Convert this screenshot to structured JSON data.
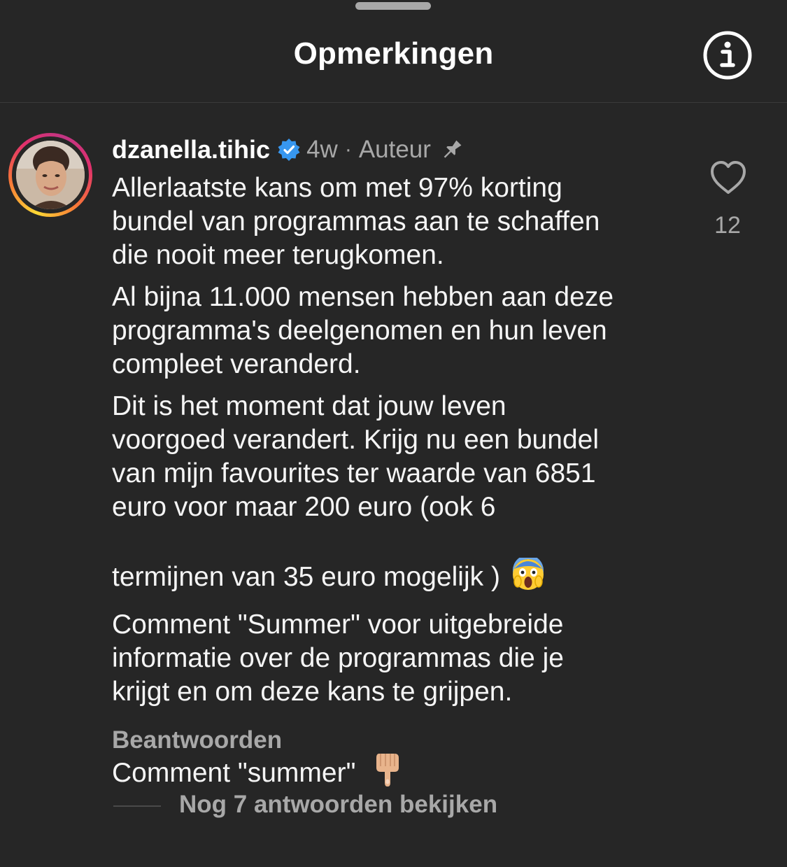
{
  "header": {
    "title": "Opmerkingen",
    "info_icon": "info-icon"
  },
  "comment": {
    "username": "dzanella.tihic",
    "verified_icon": "verified-badge-icon",
    "time": "4w",
    "separator": "·",
    "role": "Auteur",
    "pin_icon": "pin-icon",
    "paragraphs": [
      "Allerlaatste kans om met 97% korting\nbundel van programmas aan te schaffen\ndie nooit meer terugkomen.",
      "Al bijna 11.000 mensen hebben aan deze\nprogramma's deelgenomen en hun leven\ncompleet veranderd.",
      "Dit is het moment dat jouw leven\nvoorgoed verandert. Krijg nu een bundel\nvan mijn favourites ter waarde van 6851\neuro voor maar 200 euro (ook 6\ntermijnen van 35 euro mogelijk )",
      "Comment \"Summer\" voor uitgebreide\ninformatie over de programmas die je\nkrijgt en om deze kans te grijpen.",
      "Comment \"summer\""
    ],
    "emoji_1": "😱",
    "emoji_2": "👇🏼",
    "like_icon": "heart-outline-icon",
    "like_count": "12",
    "reply_label": "Beantwoorden",
    "view_replies_label": "Nog 7 antwoorden bekijken"
  },
  "colors": {
    "background": "#262626",
    "text_primary": "#f5f5f5",
    "text_secondary": "#a8a8a8",
    "verified_blue": "#3797f0",
    "divider": "#3a3a3a"
  }
}
